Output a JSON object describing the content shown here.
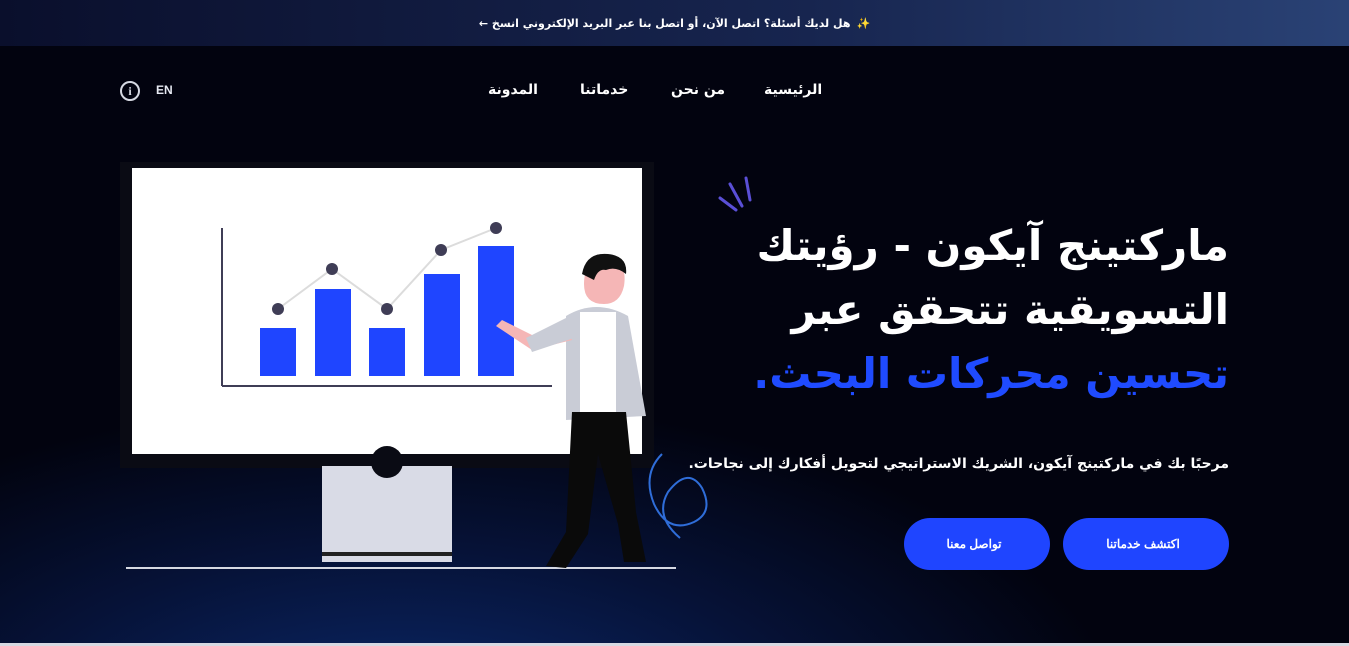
{
  "announcement": {
    "text": "هل لديك أسئلة؟ اتصل الآن، أو اتصل بنا عبر البريد الإلكتروني انسخ ←",
    "icon": "sparkle-icon"
  },
  "nav": {
    "links": [
      "الرئيسية",
      "من نحن",
      "خدماتنا",
      "المدونة"
    ],
    "lang": "EN",
    "info_icon": "info-icon"
  },
  "hero": {
    "title_line1": "ماركتينج آيكون - رؤيتك",
    "title_line2": "التسويقية تتحقق عبر",
    "title_accent": "تحسين محركات البحث.",
    "subtitle": "مرحبًا بك في ماركتينج آيكون، الشريك الاستراتيجي لتحويل أفكارك إلى نجاحات.",
    "btn_services": "اكتشف خدماتنا",
    "btn_contact": "تواصل معنا",
    "accent_color": "#1f4bff"
  }
}
